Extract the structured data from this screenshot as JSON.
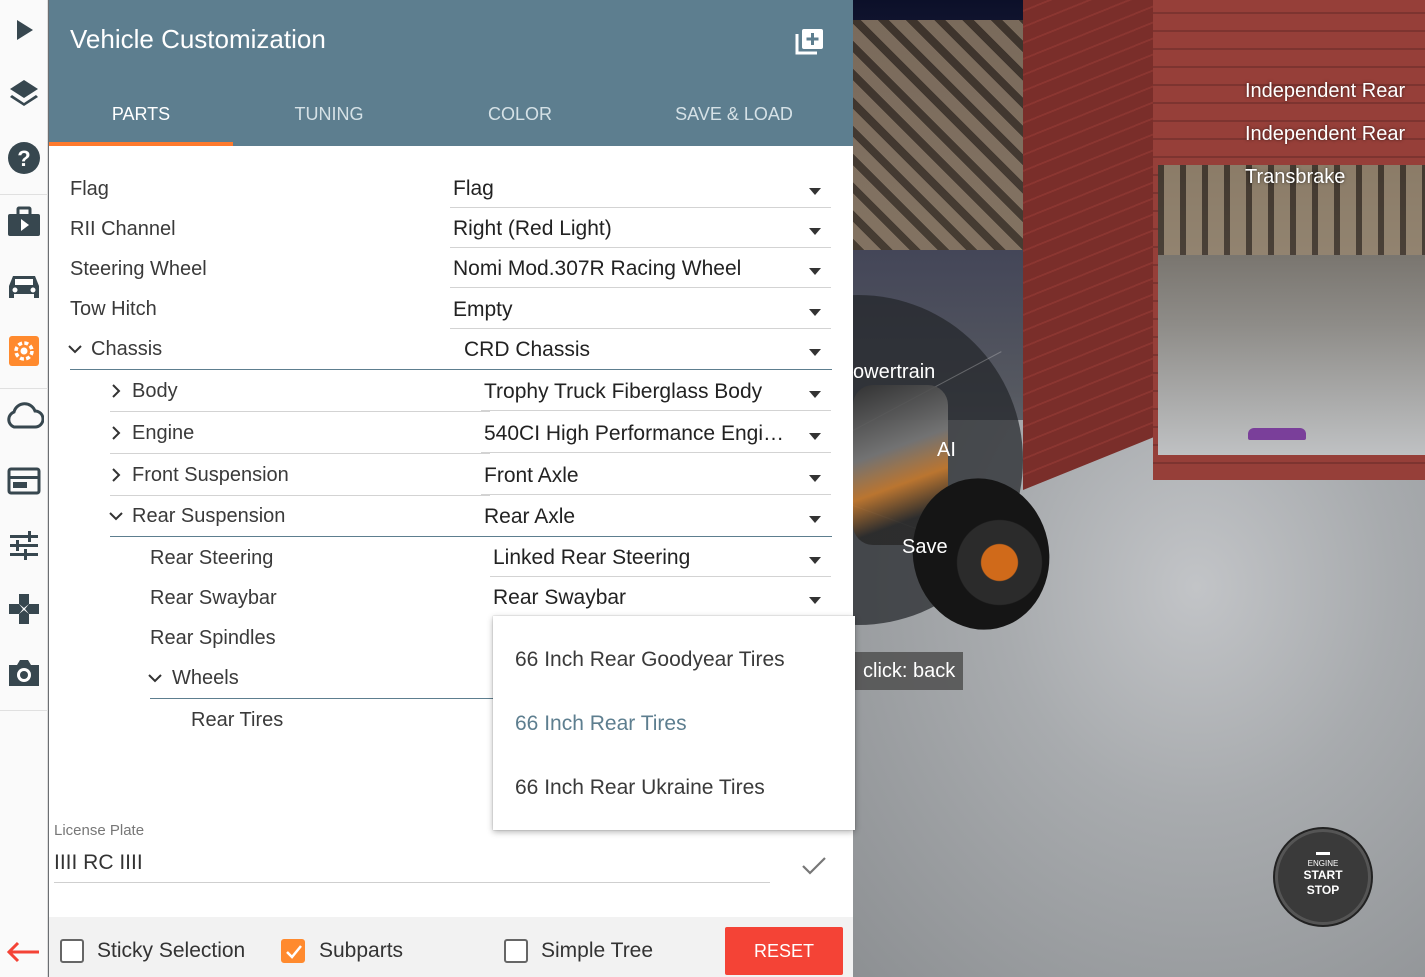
{
  "panel": {
    "title": "Vehicle Customization",
    "tabs": [
      {
        "label": "PARTS",
        "active": true
      },
      {
        "label": "TUNING",
        "active": false
      },
      {
        "label": "COLOR",
        "active": false
      },
      {
        "label": "SAVE & LOAD",
        "active": false
      }
    ]
  },
  "parts": [
    {
      "label": "Flag",
      "value": "Flag",
      "expander": "none"
    },
    {
      "label": "RII Channel",
      "value": "Right (Red Light)",
      "expander": "none"
    },
    {
      "label": "Steering Wheel",
      "value": "Nomi Mod.307R Racing Wheel",
      "expander": "none"
    },
    {
      "label": "Tow Hitch",
      "value": "Empty",
      "expander": "none"
    },
    {
      "label": "Chassis",
      "value": "CRD Chassis",
      "expander": "open"
    },
    {
      "label": "Body",
      "value": "Trophy Truck Fiberglass Body",
      "expander": "closed"
    },
    {
      "label": "Engine",
      "value": "540CI High Performance Engi…",
      "expander": "closed"
    },
    {
      "label": "Front Suspension",
      "value": "Front Axle",
      "expander": "closed"
    },
    {
      "label": "Rear Suspension",
      "value": "Rear Axle",
      "expander": "open"
    },
    {
      "label": "Rear Steering",
      "value": "Linked Rear Steering",
      "expander": "none"
    },
    {
      "label": "Rear Swaybar",
      "value": "Rear Swaybar",
      "expander": "none"
    },
    {
      "label": "Rear Spindles",
      "value": "",
      "expander": "none"
    },
    {
      "label": "Wheels",
      "value": "",
      "expander": "open"
    },
    {
      "label": "Rear Tires",
      "value": "",
      "expander": "none"
    }
  ],
  "dropdown": {
    "options": [
      {
        "label": "66 Inch Rear Goodyear Tires",
        "selected": false
      },
      {
        "label": "66 Inch Rear Tires",
        "selected": true
      },
      {
        "label": "66 Inch Rear Ukraine Tires",
        "selected": false
      }
    ]
  },
  "license_plate": {
    "label": "License Plate",
    "value": "IIII RC IIII"
  },
  "footer": {
    "sticky_selection": {
      "label": "Sticky Selection",
      "checked": false
    },
    "subparts": {
      "label": "Subparts",
      "checked": true
    },
    "simple_tree": {
      "label": "Simple Tree",
      "checked": false
    },
    "reset_label": "RESET"
  },
  "scene": {
    "radial_menu": [
      "owertrain",
      "AI",
      "Save"
    ],
    "radial_hint": "click: back",
    "overlay_list": [
      "Independent Rear",
      "Independent Rear",
      "Transbrake"
    ],
    "engine_button": {
      "small": "ENGINE",
      "line1": "START",
      "line2": "STOP"
    }
  },
  "rail": {
    "icons": [
      "play-icon",
      "layers-icon",
      "help-icon",
      "briefcase-play-icon",
      "car-icon",
      "settings-icon",
      "cloud-icon",
      "dashboard-icon",
      "sliders-icon",
      "gamepad-icon",
      "camera-icon",
      "back-arrow-icon"
    ]
  },
  "colors": {
    "header": "#5d7e8f",
    "tab_indicator": "#ff7a2d",
    "accent_orange": "#ff8a2e",
    "reset_red": "#f44336"
  }
}
